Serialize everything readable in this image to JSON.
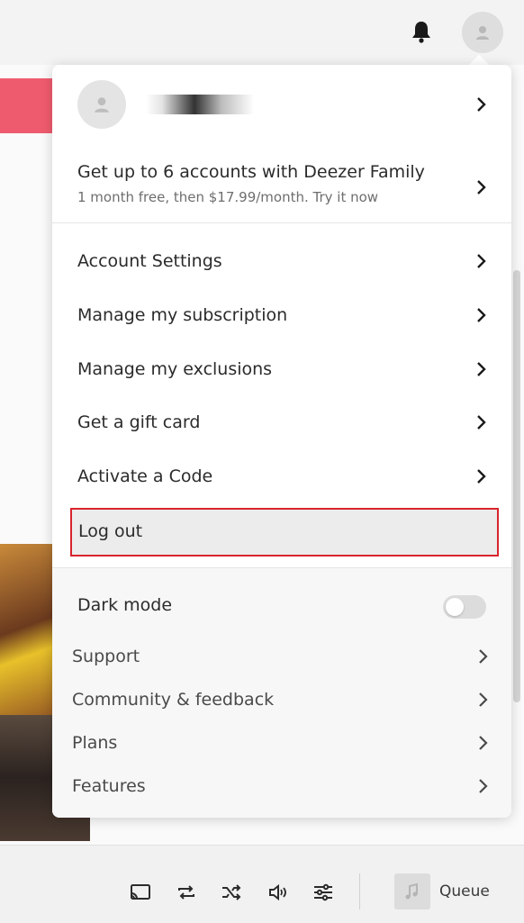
{
  "account": {
    "family": {
      "title": "Get up to 6 accounts with Deezer Family",
      "subtitle": "1 month free, then $17.99/month. Try it now"
    },
    "items": [
      {
        "label": "Account Settings"
      },
      {
        "label": "Manage my subscription"
      },
      {
        "label": "Manage my exclusions"
      },
      {
        "label": "Get a gift card"
      },
      {
        "label": "Activate a Code"
      }
    ],
    "logout": "Log out"
  },
  "settings": {
    "dark_mode": {
      "label": "Dark mode",
      "enabled": false
    },
    "links": [
      {
        "label": "Support"
      },
      {
        "label": "Community & feedback"
      },
      {
        "label": "Plans"
      },
      {
        "label": "Features"
      }
    ]
  },
  "player": {
    "queue_label": "Queue",
    "icons": [
      "cast-icon",
      "repeat-icon",
      "shuffle-icon",
      "volume-icon",
      "equalizer-icon"
    ]
  }
}
